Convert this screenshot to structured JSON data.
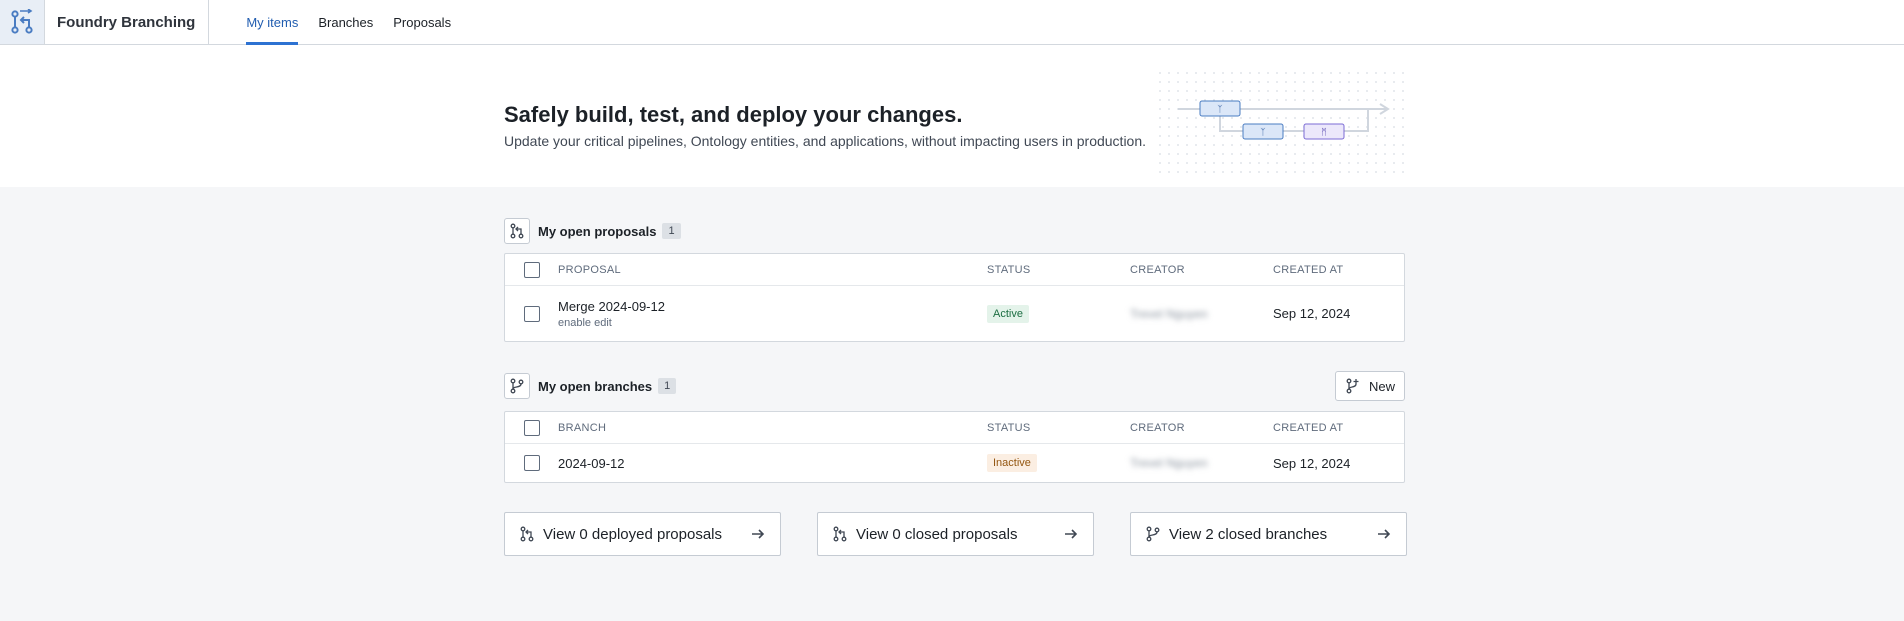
{
  "app": {
    "title": "Foundry Branching"
  },
  "nav": {
    "tabs": [
      {
        "label": "My items"
      },
      {
        "label": "Branches"
      },
      {
        "label": "Proposals"
      }
    ],
    "active": "My items"
  },
  "hero": {
    "title": "Safely build, test, and deploy your changes.",
    "subtitle": "Update your critical pipelines, Ontology entities, and applications, without impacting users in production."
  },
  "proposals": {
    "title": "My open proposals",
    "count": "1",
    "columns": [
      "PROPOSAL",
      "STATUS",
      "CREATOR",
      "CREATED AT"
    ],
    "rows": [
      {
        "name": "Merge 2024-09-12",
        "description": "enable edit",
        "status": "Active",
        "creator": "Trevel Nguyen",
        "created": "Sep 12, 2024"
      }
    ]
  },
  "branches": {
    "title": "My open branches",
    "count": "1",
    "new_label": "New",
    "columns": [
      "BRANCH",
      "STATUS",
      "CREATOR",
      "CREATED AT"
    ],
    "rows": [
      {
        "name": "2024-09-12",
        "status": "Inactive",
        "creator": "Trevel Nguyen",
        "created": "Sep 12, 2024"
      }
    ]
  },
  "cards": [
    {
      "label": "View 0 deployed proposals",
      "icon": "git-pull-icon"
    },
    {
      "label": "View 0 closed proposals",
      "icon": "git-pull-icon"
    },
    {
      "label": "View 2 closed branches",
      "icon": "git-branch-icon"
    }
  ],
  "colors": {
    "accent": "#2d72d2",
    "active_bg": "#e4f3ea",
    "inactive_bg": "#fbeee2"
  }
}
